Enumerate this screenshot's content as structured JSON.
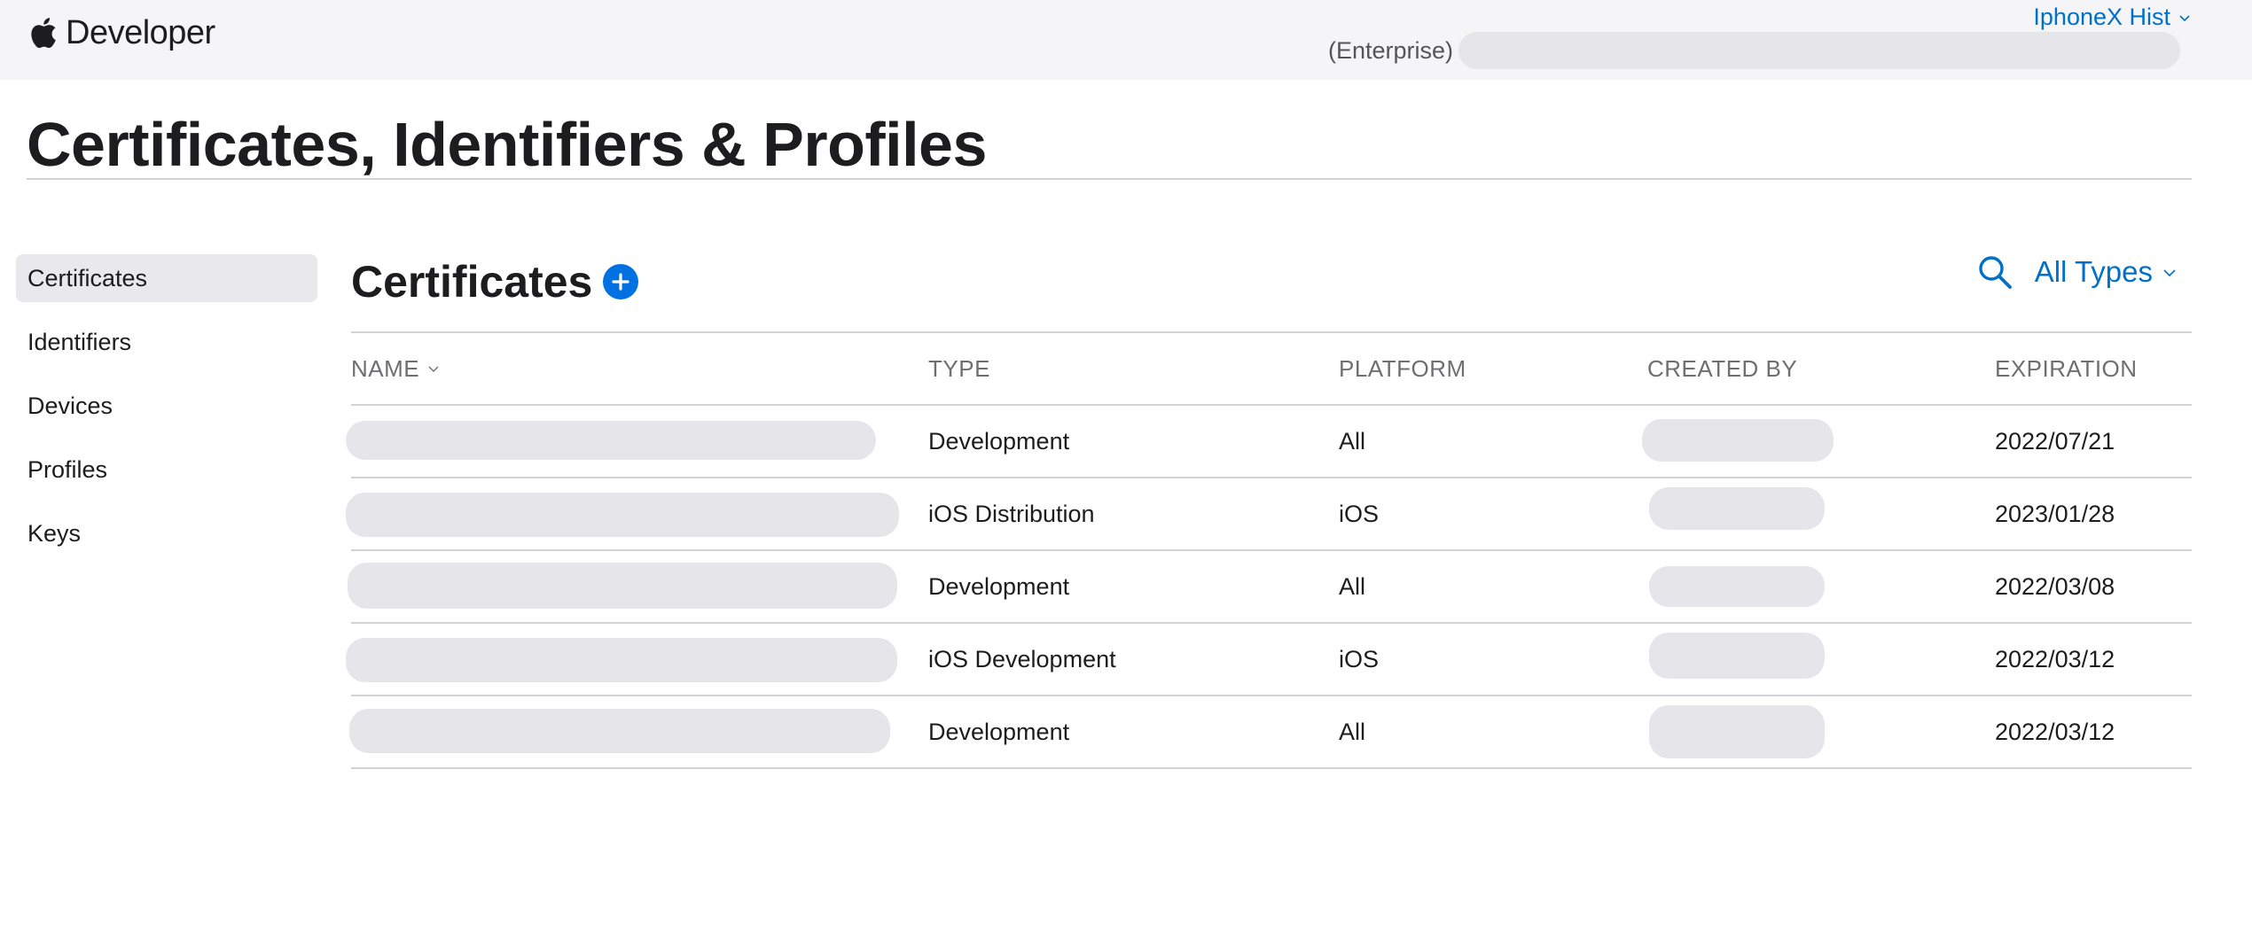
{
  "topbar": {
    "brand": "Developer",
    "brand_icon": "apple-logo-icon",
    "account_name": "IphoneX Hist",
    "team_label": "(Enterprise)"
  },
  "page_title": "Certificates, Identifiers & Profiles",
  "sidebar": {
    "items": [
      {
        "label": "Certificates",
        "active": true
      },
      {
        "label": "Identifiers",
        "active": false
      },
      {
        "label": "Devices",
        "active": false
      },
      {
        "label": "Profiles",
        "active": false
      },
      {
        "label": "Keys",
        "active": false
      }
    ]
  },
  "main": {
    "section_title": "Certificates",
    "add_icon": "plus-circle-icon",
    "search_icon": "search-icon",
    "type_filter": "All Types"
  },
  "table": {
    "columns": [
      "NAME",
      "TYPE",
      "PLATFORM",
      "CREATED BY",
      "EXPIRATION"
    ],
    "rows": [
      {
        "type": "Development",
        "platform": "All",
        "expiration": "2022/07/21"
      },
      {
        "type": "iOS Distribution",
        "platform": "iOS",
        "expiration": "2023/01/28"
      },
      {
        "type": "Development",
        "platform": "All",
        "expiration": "2022/03/08"
      },
      {
        "type": "iOS Development",
        "platform": "iOS",
        "expiration": "2022/03/12"
      },
      {
        "type": "Development",
        "platform": "All",
        "expiration": "2022/03/12"
      }
    ]
  },
  "colors": {
    "accent": "#0070c9",
    "add_button": "#0071e3",
    "topbar_bg": "#f5f5f7",
    "redaction": "#e5e5ea",
    "divider": "#d2d2d7"
  }
}
